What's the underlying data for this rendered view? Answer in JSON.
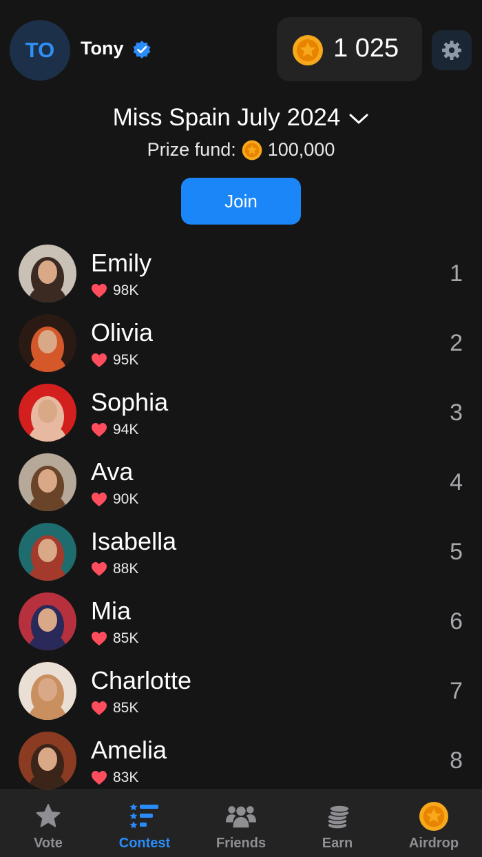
{
  "header": {
    "avatar_initials": "TO",
    "username": "Tony",
    "coin_balance": "1 025"
  },
  "contest": {
    "title": "Miss Spain July 2024",
    "prize_label": "Prize fund:",
    "prize_value": "100,000",
    "join_label": "Join"
  },
  "leaderboard": [
    {
      "name": "Emily",
      "likes": "98K",
      "rank": "1",
      "colors": [
        "#c9c0b6",
        "#3a2a22"
      ]
    },
    {
      "name": "Olivia",
      "likes": "95K",
      "rank": "2",
      "colors": [
        "#2b1a14",
        "#d4582a"
      ]
    },
    {
      "name": "Sophia",
      "likes": "94K",
      "rank": "3",
      "colors": [
        "#d41f1f",
        "#e7b9a0"
      ]
    },
    {
      "name": "Ava",
      "likes": "90K",
      "rank": "4",
      "colors": [
        "#b7a99a",
        "#6a4429"
      ]
    },
    {
      "name": "Isabella",
      "likes": "88K",
      "rank": "5",
      "colors": [
        "#1f6c6e",
        "#a33a2b"
      ]
    },
    {
      "name": "Mia",
      "likes": "85K",
      "rank": "6",
      "colors": [
        "#b6313d",
        "#2a2a5a"
      ]
    },
    {
      "name": "Charlotte",
      "likes": "85K",
      "rank": "7",
      "colors": [
        "#e9dfd4",
        "#c98f5f"
      ]
    },
    {
      "name": "Amelia",
      "likes": "83K",
      "rank": "8",
      "colors": [
        "#8a3b22",
        "#3b2418"
      ]
    }
  ],
  "nav": {
    "vote": "Vote",
    "contest": "Contest",
    "friends": "Friends",
    "earn": "Earn",
    "airdrop": "Airdrop"
  },
  "colors": {
    "background": "#151516",
    "accent": "#1b86f7",
    "coin": "#f7a81b",
    "heart": "#ff4d5e"
  }
}
